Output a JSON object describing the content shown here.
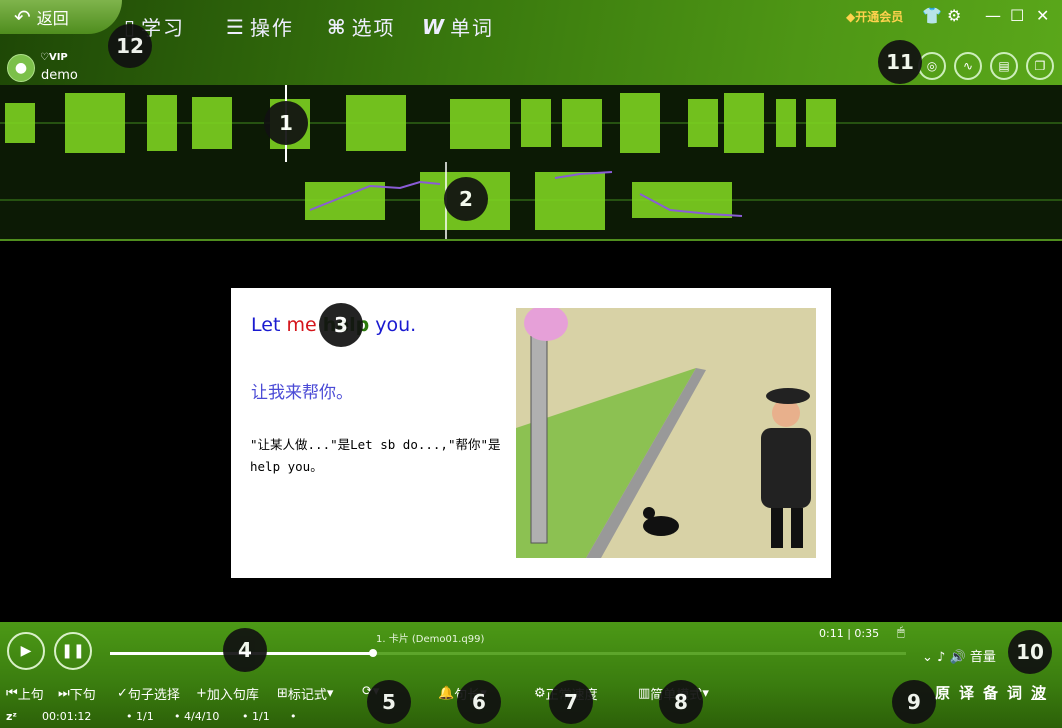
{
  "header": {
    "back_label": "返回",
    "menu": [
      {
        "label": "学习",
        "icon": "book-icon"
      },
      {
        "label": "操作",
        "icon": "menu-icon"
      },
      {
        "label": "选项",
        "icon": "options-icon"
      },
      {
        "label": "单词",
        "icon": "word-icon"
      }
    ],
    "vip_label": "VIP",
    "username": "demo",
    "member_label": "开通会员"
  },
  "card": {
    "en_word1": "Let",
    "en_word2": "me",
    "en_word3": "help",
    "en_word4": "you.",
    "zh": "让我来帮你。",
    "note_line1": "\"让某人做...\"是Let sb do...,\"帮你\"是",
    "note_line2": "help you。"
  },
  "player": {
    "track_title": "1. 卡片 (Demo01.q99)",
    "time": "0:11 | 0:35",
    "progress": 0.33,
    "volume_label": "音量",
    "controls": {
      "prev": "上句",
      "next": "下句",
      "sentence_select": "句子选择",
      "add_to_bank": "加入句库",
      "mark_mode": "标记式",
      "repeat": "",
      "sentence_time": "句长",
      "speed": "正常速度",
      "simple_mode": "简单模式"
    },
    "status": {
      "elapsed": "00:01:12",
      "s1": "1/1",
      "s2": "4/4/10",
      "s3": "1/1"
    },
    "mode_buttons": [
      "原",
      "译",
      "备",
      "词",
      "波"
    ]
  },
  "markers": [
    "1",
    "2",
    "3",
    "4",
    "5",
    "6",
    "7",
    "8",
    "9",
    "10",
    "11",
    "12"
  ],
  "colors": {
    "accent": "#3a7c0f",
    "wave": "#7ed321",
    "pitch": "#8a5cd6"
  }
}
